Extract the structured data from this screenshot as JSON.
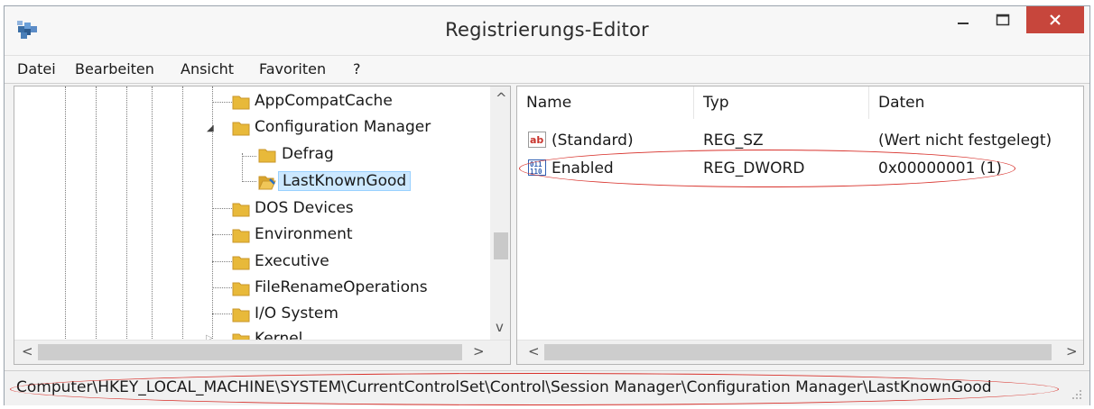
{
  "window": {
    "title": "Registrierungs-Editor",
    "icon": "regedit-icon",
    "controls": {
      "minimize": "–",
      "maximize": "□",
      "close": "×"
    }
  },
  "menu": {
    "items": [
      "Datei",
      "Bearbeiten",
      "Ansicht",
      "Favoriten",
      "?"
    ]
  },
  "tree": {
    "nodes": [
      {
        "label": "AppCompatCache",
        "expander": "",
        "selected": false,
        "icon": "folder-icon"
      },
      {
        "label": "Configuration Manager",
        "expander": "◢",
        "selected": false,
        "icon": "folder-icon"
      },
      {
        "label": "Defrag",
        "expander": "",
        "selected": false,
        "icon": "folder-icon"
      },
      {
        "label": "LastKnownGood",
        "expander": "",
        "selected": true,
        "icon": "folder-open-icon"
      },
      {
        "label": "DOS Devices",
        "expander": "",
        "selected": false,
        "icon": "folder-icon"
      },
      {
        "label": "Environment",
        "expander": "",
        "selected": false,
        "icon": "folder-icon"
      },
      {
        "label": "Executive",
        "expander": "",
        "selected": false,
        "icon": "folder-icon"
      },
      {
        "label": "FileRenameOperations",
        "expander": "",
        "selected": false,
        "icon": "folder-icon"
      },
      {
        "label": "I/O System",
        "expander": "",
        "selected": false,
        "icon": "folder-icon"
      },
      {
        "label": "Kernel",
        "expander": "▷",
        "selected": false,
        "icon": "folder-icon"
      }
    ],
    "scroll": {
      "up": "^",
      "down": "v",
      "left": "<",
      "right": ">"
    }
  },
  "values_list": {
    "columns": [
      "Name",
      "Typ",
      "Daten"
    ],
    "rows": [
      {
        "name": "(Standard)",
        "type": "REG_SZ",
        "data": "(Wert nicht festgelegt)",
        "icon": "string-value-icon"
      },
      {
        "name": "Enabled",
        "type": "REG_DWORD",
        "data": "0x00000001 (1)",
        "icon": "binary-value-icon"
      }
    ],
    "scroll": {
      "left": "<",
      "right": ">"
    }
  },
  "status": {
    "path": "Computer\\HKEY_LOCAL_MACHINE\\SYSTEM\\CurrentControlSet\\Control\\Session Manager\\Configuration Manager\\LastKnownGood"
  },
  "colors": {
    "highlight_ellipse": "#d8322c",
    "close_button": "#c7463c",
    "selection": "#cce8ff",
    "folder": "#e8b93a"
  }
}
